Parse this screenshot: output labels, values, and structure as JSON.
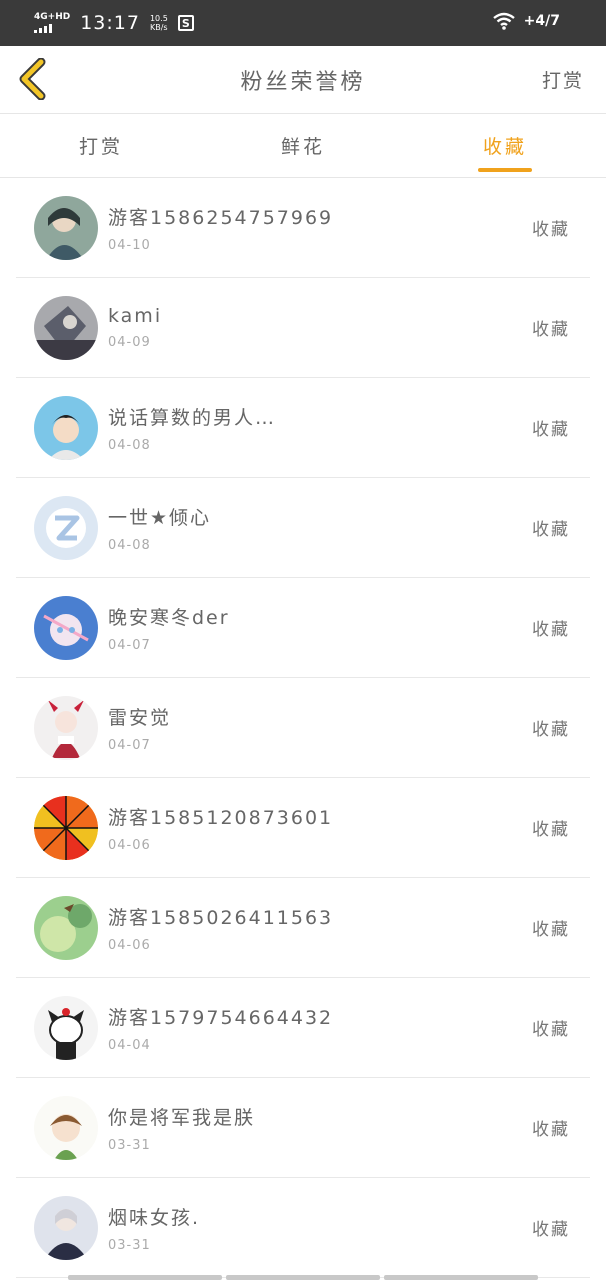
{
  "status_bar": {
    "network": "4G+HD",
    "time": "13:17",
    "speed_value": "10.5",
    "speed_unit": "KB/s",
    "battery_text": "+4/7"
  },
  "header": {
    "title": "粉丝荣誉榜",
    "action": "打赏"
  },
  "tabs": [
    {
      "label": "打赏"
    },
    {
      "label": "鲜花"
    },
    {
      "label": "收藏"
    }
  ],
  "active_tab": "收藏",
  "accent_color": "#f0a21c",
  "rows": [
    {
      "name": "游客1586254757969",
      "date": "04-10",
      "type": "收藏"
    },
    {
      "name": "kami",
      "date": "04-09",
      "type": "收藏"
    },
    {
      "name": "说话算数的男人…",
      "date": "04-08",
      "type": "收藏"
    },
    {
      "name": "一世★倾心",
      "date": "04-08",
      "type": "收藏"
    },
    {
      "name": "晚安寒冬der",
      "date": "04-07",
      "type": "收藏"
    },
    {
      "name": "雷安觉",
      "date": "04-07",
      "type": "收藏"
    },
    {
      "name": "游客1585120873601",
      "date": "04-06",
      "type": "收藏"
    },
    {
      "name": "游客1585026411563",
      "date": "04-06",
      "type": "收藏"
    },
    {
      "name": "游客1579754664432",
      "date": "04-04",
      "type": "收藏"
    },
    {
      "name": "你是将军我是朕",
      "date": "03-31",
      "type": "收藏"
    },
    {
      "name": "烟味女孩.",
      "date": "03-31",
      "type": "收藏"
    }
  ]
}
